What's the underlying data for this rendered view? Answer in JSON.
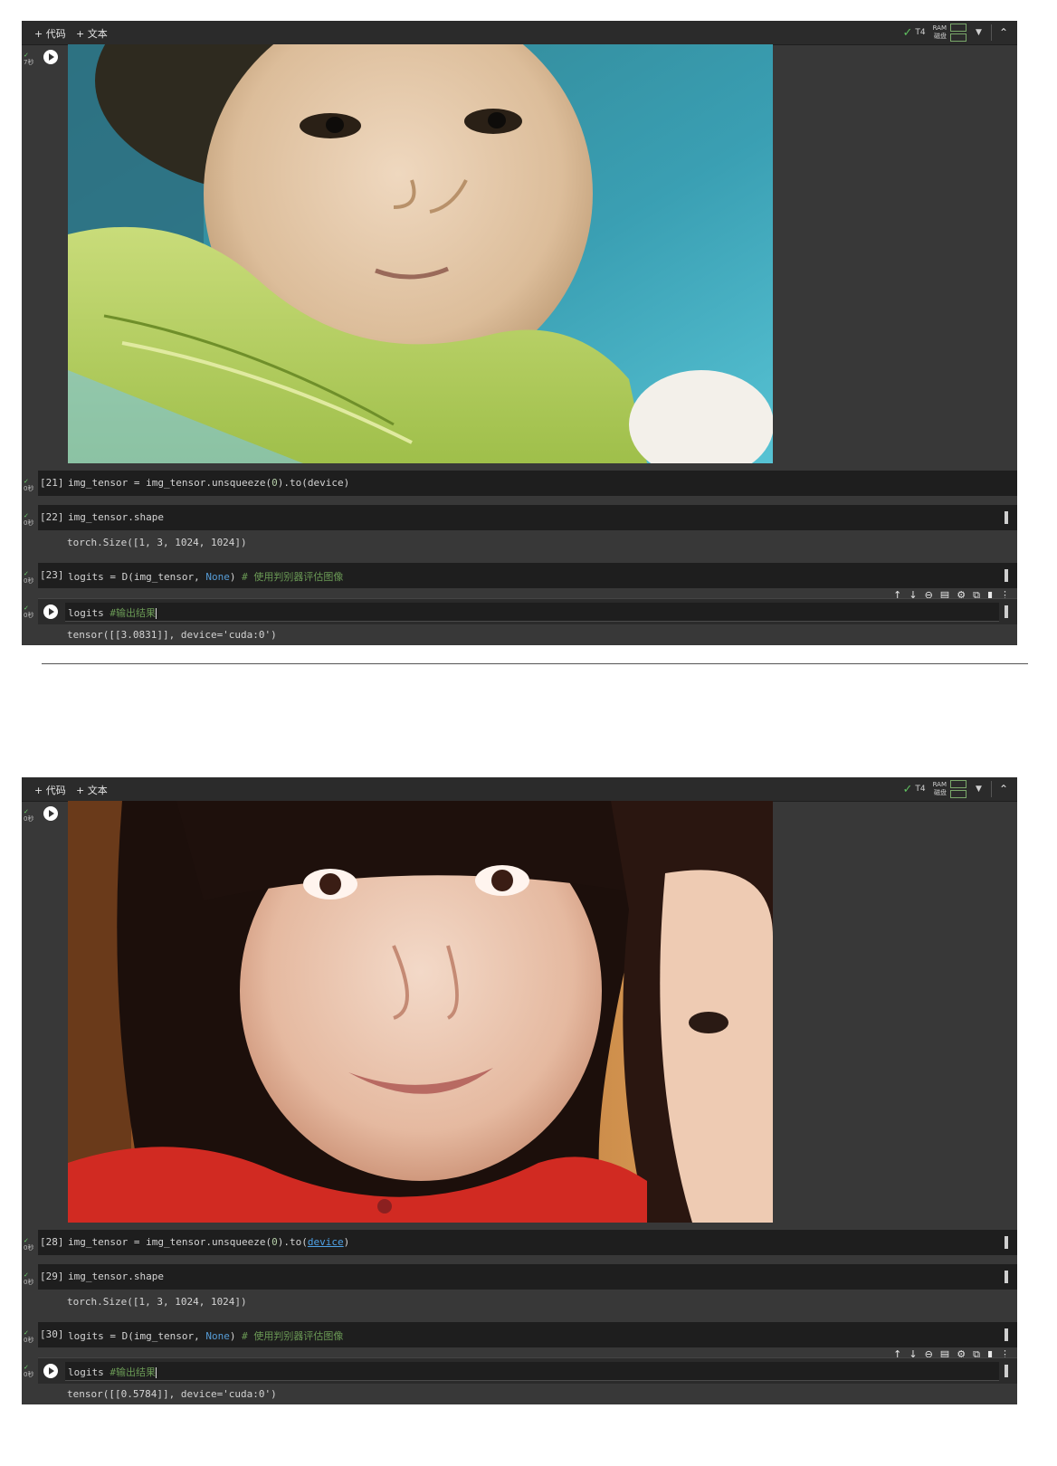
{
  "toolbar": {
    "add_code": "+ 代码",
    "add_text": "+ 文本",
    "runtime": "T4",
    "ram_label": "RAM",
    "disk_label": "磁盘"
  },
  "panels": [
    {
      "image_cell_status": "7秒",
      "cells": [
        {
          "exec": "[21]",
          "code_a": "img_tensor = img_tensor.unsqueeze(",
          "code_num": "0",
          "code_b": ").to(device)",
          "status": "0秒"
        },
        {
          "exec": "[22]",
          "code": "img_tensor.shape",
          "status": "0秒",
          "output": "torch.Size([1, 3, 1024, 1024])"
        },
        {
          "exec": "[23]",
          "code_a": "logits = D(img_tensor, ",
          "code_kw": "None",
          "code_b": ") ",
          "code_comment": "# 使用判别器评估图像",
          "status": "0秒"
        },
        {
          "code_a": "logits ",
          "code_comment": "#输出结果",
          "status": "0秒",
          "output": "tensor([[3.0831]], device='cuda:0')"
        }
      ]
    },
    {
      "image_cell_status": "0秒",
      "cells": [
        {
          "exec": "[28]",
          "code_a": "img_tensor = img_tensor.unsqueeze(",
          "code_num": "0",
          "code_b": ").to(",
          "code_link": "device",
          "code_c": ")",
          "status": "0秒"
        },
        {
          "exec": "[29]",
          "code": "img_tensor.shape",
          "status": "0秒",
          "output": "torch.Size([1, 3, 1024, 1024])"
        },
        {
          "exec": "[30]",
          "code_a": "logits = D(img_tensor, ",
          "code_kw": "None",
          "code_b": ") ",
          "code_comment": "# 使用判别器评估图像",
          "status": "0秒"
        },
        {
          "code_a": "logits ",
          "code_comment": "#输出结果",
          "status": "0秒",
          "output": "tensor([[0.5784]], device='cuda:0')"
        }
      ]
    }
  ]
}
